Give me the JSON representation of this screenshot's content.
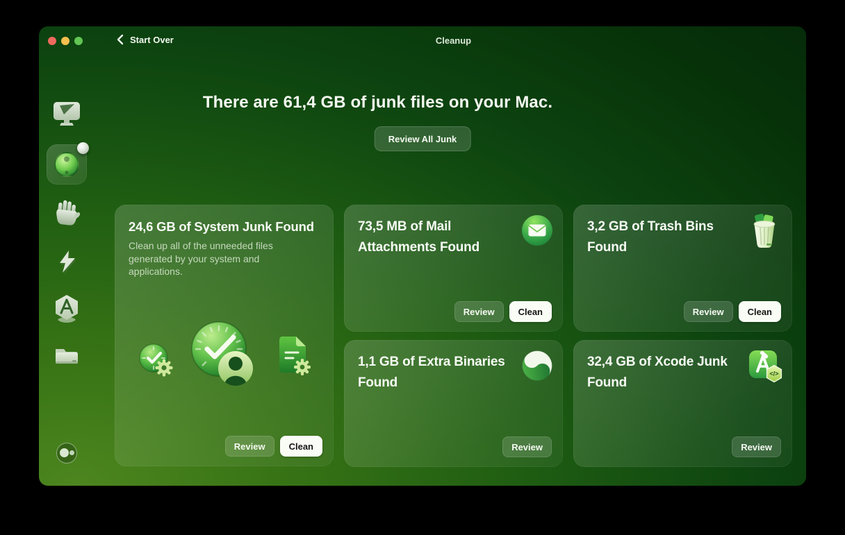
{
  "titlebar": {
    "back": "Start Over",
    "title": "Cleanup"
  },
  "hero": {
    "headline": "There are 61,4 GB of junk files on your Mac.",
    "cta": "Review All Junk"
  },
  "sidebar": {
    "items": [
      {
        "id": "smart-scan",
        "icon": "monitor-icon",
        "selected": false
      },
      {
        "id": "cleanup",
        "icon": "cleanup-ball-icon",
        "selected": true,
        "has_badge": true
      },
      {
        "id": "protection",
        "icon": "hand-icon",
        "selected": false
      },
      {
        "id": "performance",
        "icon": "lightning-icon",
        "selected": false
      },
      {
        "id": "applications",
        "icon": "appstore-icon",
        "selected": false
      },
      {
        "id": "files",
        "icon": "folder-icon",
        "selected": false
      }
    ],
    "assistant_icon": "assistant-toggle-icon"
  },
  "cards": [
    {
      "title": "24,6 GB of System Junk Found",
      "description": "Clean up all of the unneeded files generated by your system and applications.",
      "icons": [
        "clock-gear-icon",
        "clock-user-icon",
        "document-gear-icon"
      ],
      "review": "Review",
      "clean": "Clean"
    },
    {
      "title": "73,5 MB of Mail Attachments Found",
      "icon": "mail-icon",
      "review": "Review",
      "clean": "Clean"
    },
    {
      "title": "3,2 GB of Trash Bins Found",
      "icon": "trash-icon",
      "review": "Review",
      "clean": "Clean"
    },
    {
      "title": "1,1 GB of Extra Binaries Found",
      "icon": "binaries-icon",
      "review": "Review"
    },
    {
      "title": "32,4 GB of Xcode Junk Found",
      "icon": "xcode-icon",
      "review": "Review"
    }
  ],
  "icons": {
    "xcode_badge": "</>"
  },
  "colors": {
    "traffic_red": "#ee6a5f",
    "traffic_yellow": "#f5bf4f",
    "traffic_green": "#61c554",
    "accent_green": "#2f9e3f",
    "window_bg_light": "#4d861f",
    "window_bg_dark": "#052a09",
    "clean_button_bg": "#fafcf6"
  }
}
